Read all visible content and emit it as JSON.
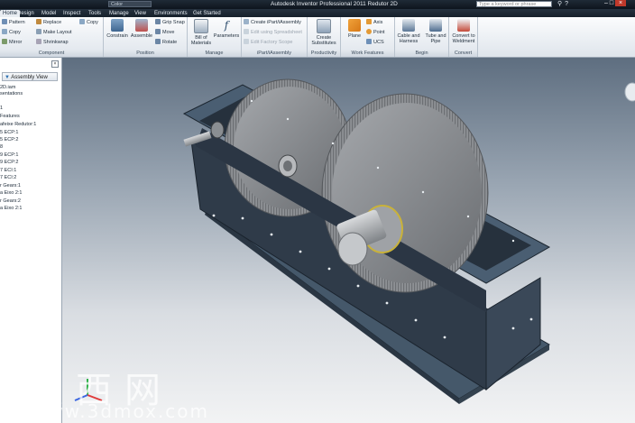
{
  "app": {
    "title": "Autodesk Inventor Professional 2011    Redutor 2D",
    "search_placeholder": "Type a keyword or phrase",
    "quick_access_value": "Color"
  },
  "tabs": [
    {
      "label": "Home",
      "active": true
    },
    {
      "label": "Design",
      "active": false
    },
    {
      "label": "Model",
      "active": false
    },
    {
      "label": "Inspect",
      "active": false
    },
    {
      "label": "Tools",
      "active": false
    },
    {
      "label": "Manage",
      "active": false
    },
    {
      "label": "View",
      "active": false
    },
    {
      "label": "Environments",
      "active": false
    },
    {
      "label": "Get Started",
      "active": false
    }
  ],
  "ribbon": {
    "component": {
      "title": "Component",
      "pattern": "Pattern",
      "replace": "Replace",
      "copy_top": "Copy",
      "copy": "Copy",
      "make_layout": "Make Layout",
      "mirror": "Mirror",
      "shrinkwrap": "Shrinkwrap"
    },
    "position": {
      "title": "Position",
      "constrain": "Constrain",
      "assemble": "Assemble",
      "grip_snap": "Grip Snap",
      "move": "Move",
      "rotate": "Rotate"
    },
    "manage": {
      "title": "Manage",
      "bill_line1": "Bill of",
      "bill_line2": "Materials",
      "parameters": "Parameters"
    },
    "ipart": {
      "title": "iPart/iAssembly",
      "create": "Create iPart/iAssembly",
      "edit_spreadsheet": "Edit using Spreadsheet",
      "edit_factory": "Edit Factory Scope"
    },
    "productivity": {
      "title": "Productivity",
      "create_line1": "Create",
      "create_line2": "Substitutes"
    },
    "work_features": {
      "title": "Work Features",
      "plane": "Plane",
      "axis": "Axis",
      "point": "Point",
      "ucs": "UCS"
    },
    "begin": {
      "title": "Begin",
      "cable_line1": "Cable and",
      "cable_line2": "Harness",
      "tube_line1": "Tube and",
      "tube_line2": "Pipe"
    },
    "convert": {
      "title": "Convert",
      "line1": "Convert to",
      "line2": "Weldment"
    }
  },
  "browser": {
    "view_label": "Assembly View",
    "items": [
      "2D.iam",
      "sentations",
      "1",
      "Features",
      "afeixe Redutor:1",
      "5 ECP:1",
      "5 ECP:2",
      "8",
      "9 ECP:1",
      "9 ECP:2",
      "7 ECI:1",
      "7 ECI:2",
      "r Gears:1",
      "a Eixo 2:1",
      "r Gears:2",
      "a Eixo 2:1"
    ]
  },
  "watermark": {
    "chinese": "莫西网",
    "url": "www.3dmox.com"
  },
  "colors": {
    "housing": "#2f3b49",
    "flange": "#45586a",
    "gear": "#8d9094",
    "shaft": "#b9bcbf",
    "bearing_accent": "#c9b23a"
  },
  "icons": [
    "search-icon",
    "help-icon",
    "minimize-icon",
    "maximize-icon",
    "close-icon",
    "viewcube-icon",
    "axis-triad-icon"
  ]
}
